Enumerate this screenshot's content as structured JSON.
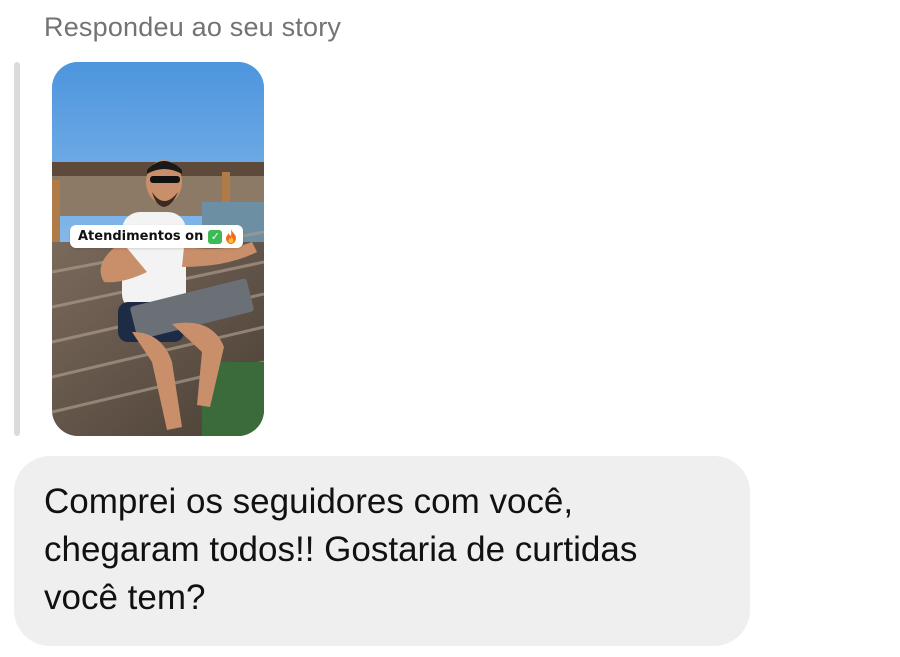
{
  "thread": {
    "reply_context_label": "Respondeu ao seu story"
  },
  "story": {
    "sticker_text": "Atendimentos on",
    "sticker_emojis": [
      "check-mark-button-icon",
      "fire-icon"
    ]
  },
  "message": {
    "text": "Comprei os seguidores com você, chegaram todos!! Gostaria de curtidas você tem?"
  },
  "colors": {
    "bubble_background": "#efefef",
    "secondary_text": "#737373",
    "primary_text": "#111111",
    "quote_bar": "#dbdbdb"
  }
}
